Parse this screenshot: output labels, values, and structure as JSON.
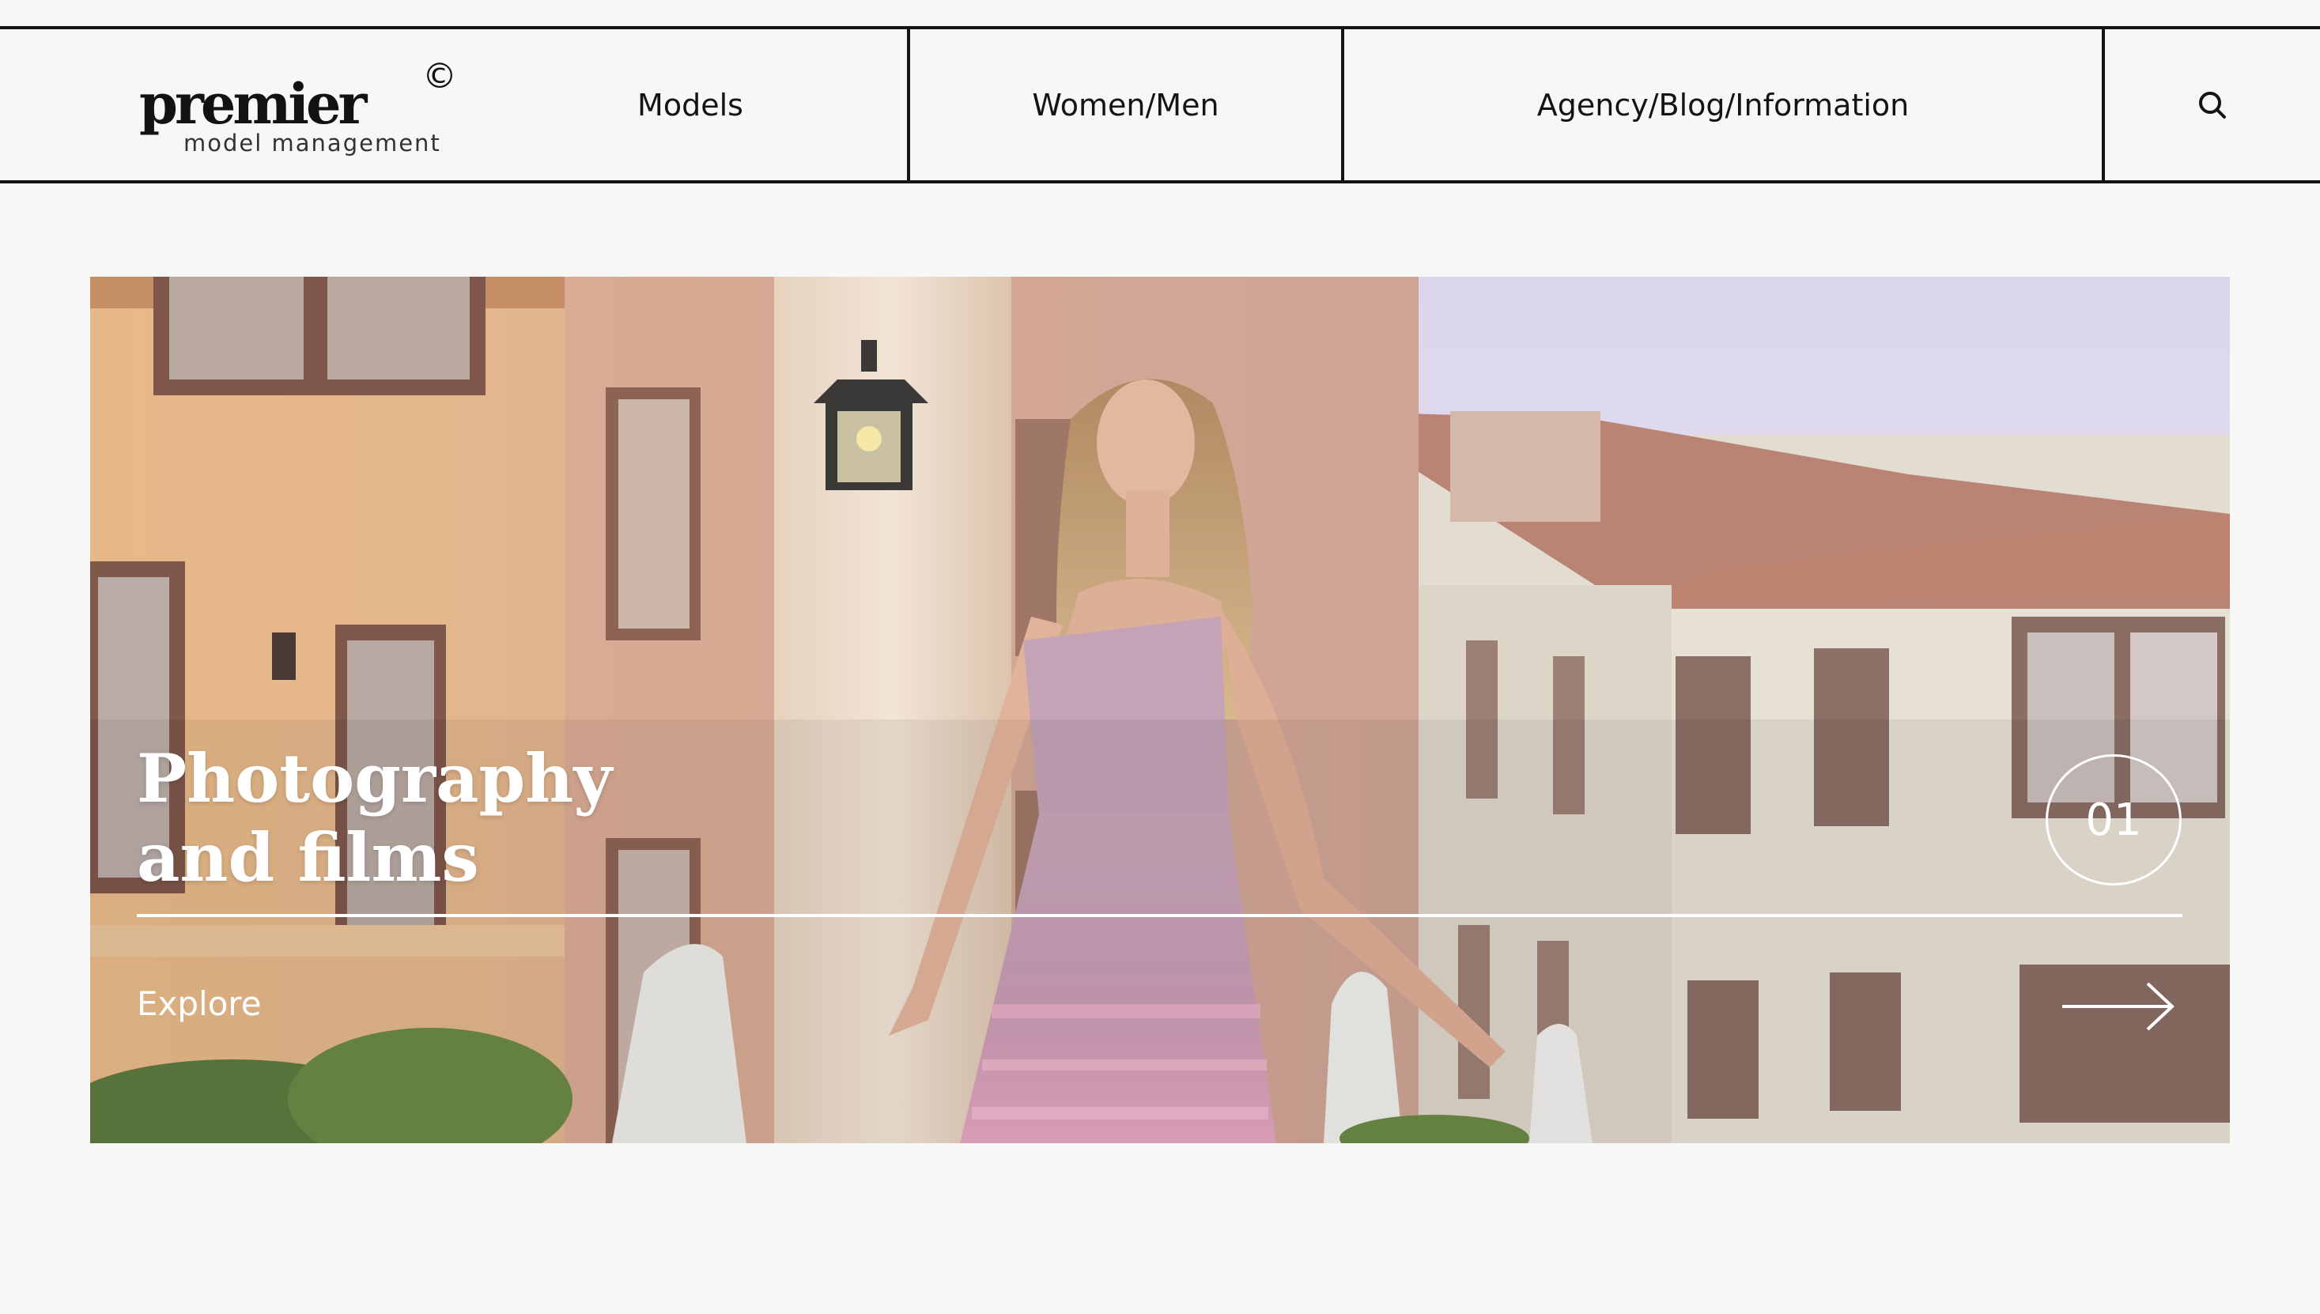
{
  "header": {
    "logo": {
      "wordmark": "premier",
      "copyright_symbol": "©",
      "tagline": "model management"
    },
    "nav": [
      {
        "label": "Models"
      },
      {
        "label": "Women/Men"
      },
      {
        "label": "Agency/Blog/Information"
      }
    ],
    "search_icon": "search-icon"
  },
  "hero": {
    "title_line1": "Photography",
    "title_line2": "and films",
    "slide_number": "01",
    "explore_label": "Explore",
    "next_icon": "arrow-right-icon"
  },
  "colors": {
    "background": "#f7f7f7",
    "border": "#141414",
    "hero_text": "#ffffff"
  }
}
